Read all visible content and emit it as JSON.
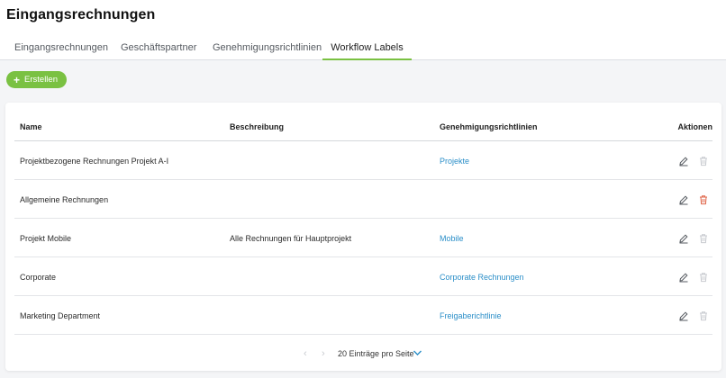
{
  "header": {
    "title": "Eingangsrechnungen"
  },
  "tabs": [
    {
      "label": "Eingangsrechnungen"
    },
    {
      "label": "Geschäftspartner"
    },
    {
      "label": "Genehmigungsrichtlinien"
    },
    {
      "label": "Workflow Labels"
    }
  ],
  "active_tab": "Workflow Labels",
  "toolbar": {
    "create_label": "Erstellen"
  },
  "table": {
    "columns": [
      "Name",
      "Beschreibung",
      "Genehmigungsrichtlinien",
      "Aktionen"
    ],
    "rows": [
      {
        "name": "Projektbezogene Rechnungen Projekt A-I",
        "description": "",
        "rule": "Projekte"
      },
      {
        "name": "Allgemeine Rechnungen",
        "description": "",
        "rule": ""
      },
      {
        "name": "Projekt Mobile",
        "description": "Alle Rechnungen für Hauptprojekt",
        "rule": "Mobile"
      },
      {
        "name": "Corporate",
        "description": "",
        "rule": "Corporate Rechnungen"
      },
      {
        "name": "Marketing Department",
        "description": "",
        "rule": "Freigaberichtlinie"
      }
    ]
  },
  "pagination": {
    "per_page_label": "20 Einträge pro Seite"
  },
  "colors": {
    "accent": "#7ac142",
    "link": "#2a8ec8",
    "delete_active": "#e0664a",
    "disabled": "#c7cacf"
  },
  "icons": {
    "create": "plus-icon",
    "edit": "pencil-icon",
    "delete": "trash-icon",
    "prev": "chevron-left-icon",
    "next": "chevron-right-icon",
    "dropdown": "chevron-down-icon"
  }
}
